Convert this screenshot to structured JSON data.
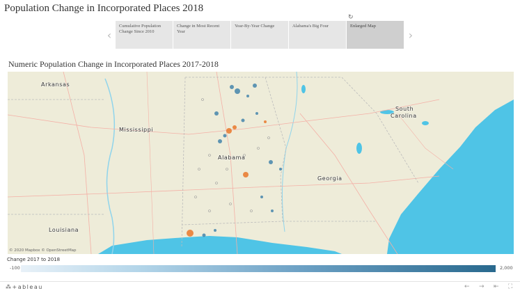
{
  "page": {
    "title": "Population Change in Incorporated Places 2018"
  },
  "tabs": {
    "items": [
      {
        "label": "Cumulative Population Change Since 2010"
      },
      {
        "label": "Change in Most Recent Year"
      },
      {
        "label": "Year-By-Year Change"
      },
      {
        "label": "Alabama's Big Four"
      },
      {
        "label": "Enlarged Map",
        "active": true
      }
    ],
    "prev_icon": "chevron-left-icon",
    "next_icon": "chevron-right-icon",
    "refresh_icon": "refresh-icon"
  },
  "map": {
    "title": "Numeric Population Change in Incorporated Places 2017-2018",
    "labels": {
      "arkansas": "Arkansas",
      "mississippi": "Mississippi",
      "alabama": "Alabama",
      "georgia": "Georgia",
      "south": "South",
      "carolina": "Carolina",
      "louisiana": "Louisiana"
    },
    "attribution": "© 2020 Mapbox © OpenStreetMap",
    "colors": {
      "land": "#eeecd9",
      "water": "#4fc4e6",
      "grow": "#3a7ea8",
      "decline": "#e9782a"
    }
  },
  "legend": {
    "title": "Change 2017 to 2018",
    "min": "-100",
    "max": "2,000",
    "colors": {
      "low": "#e8f1f8",
      "high": "#29698e"
    }
  },
  "footer": {
    "brand": "+ableau",
    "icons": [
      "tableau-logo-icon",
      "undo-icon",
      "redo-icon",
      "revert-icon",
      "fullscreen-icon"
    ]
  }
}
